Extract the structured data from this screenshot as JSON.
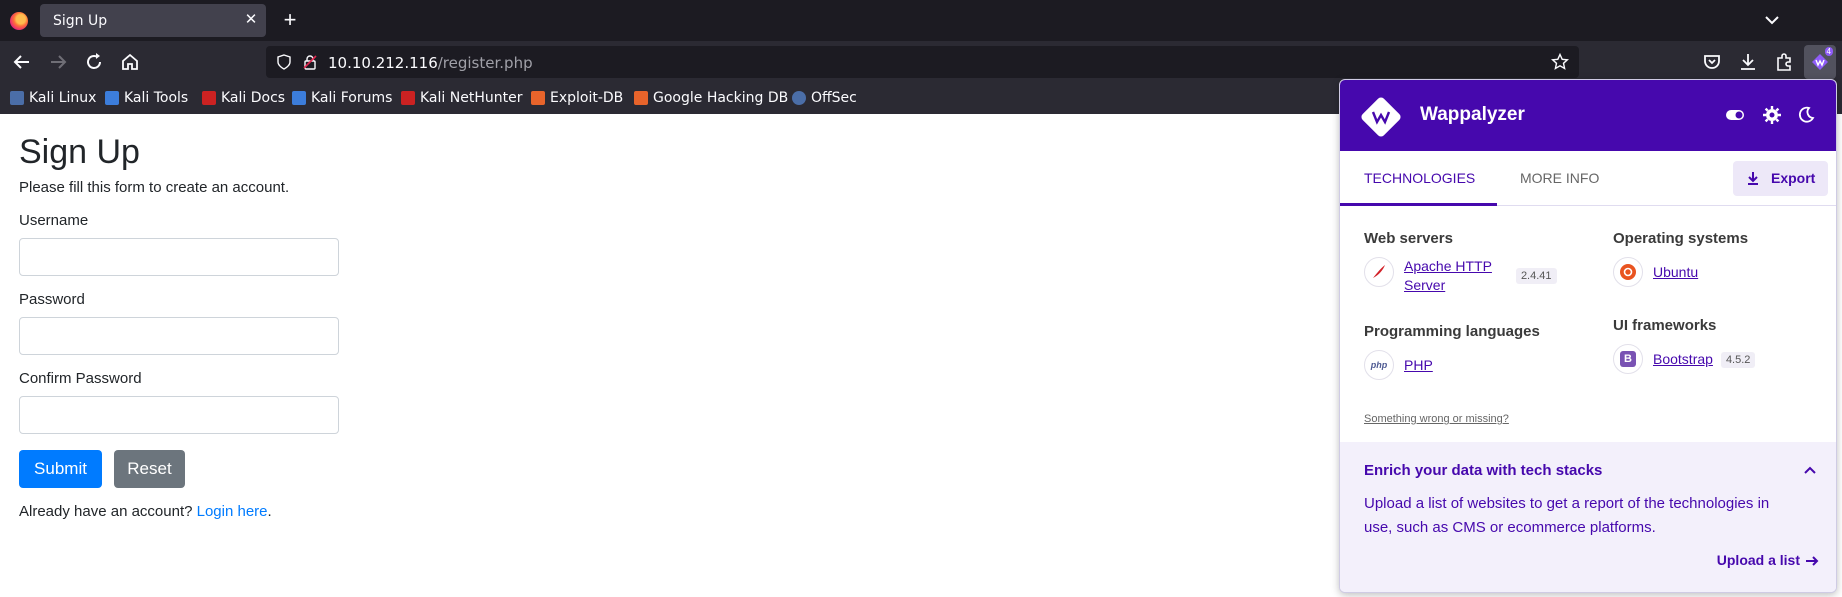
{
  "browser": {
    "tab_title": "Sign Up",
    "url_host": "10.10.212.116",
    "url_path": "/register.php",
    "bookmarks": [
      {
        "label": "Kali Linux",
        "color": "#4b6ea8"
      },
      {
        "label": "Kali Tools",
        "color": "#3c7ddb"
      },
      {
        "label": "Kali Docs",
        "color": "#cc2222"
      },
      {
        "label": "Kali Forums",
        "color": "#3c7ddb"
      },
      {
        "label": "Kali NetHunter",
        "color": "#cc2222"
      },
      {
        "label": "Exploit-DB",
        "color": "#e8642b"
      },
      {
        "label": "Google Hacking DB",
        "color": "#e8642b"
      },
      {
        "label": "OffSec",
        "color": "#4b6ea8"
      }
    ]
  },
  "page": {
    "title": "Sign Up",
    "subtitle": "Please fill this form to create an account.",
    "username_label": "Username",
    "password_label": "Password",
    "confirm_label": "Confirm Password",
    "submit_label": "Submit",
    "reset_label": "Reset",
    "already_text": "Already have an account? ",
    "login_link": "Login here",
    "period": "."
  },
  "wappalyzer": {
    "name": "Wappalyzer",
    "tab_technologies": "TECHNOLOGIES",
    "tab_more_info": "MORE INFO",
    "export_label": "Export",
    "categories": {
      "web_servers": "Web servers",
      "operating_systems": "Operating systems",
      "programming_languages": "Programming languages",
      "ui_frameworks": "UI frameworks"
    },
    "techs": {
      "apache_line1": "Apache HTTP",
      "apache_line2": "Server",
      "apache_version": "2.4.41",
      "ubuntu": "Ubuntu",
      "php": "PHP",
      "bootstrap": "Bootstrap",
      "bootstrap_version": "4.5.2"
    },
    "something_wrong": "Something wrong or missing?",
    "enrich_title": "Enrich your data with tech stacks",
    "enrich_body": "Upload a list of websites to get a report of the technologies in use, such as CMS or ecommerce platforms.",
    "upload_label": "Upload a list",
    "accent": "#4608ad"
  }
}
